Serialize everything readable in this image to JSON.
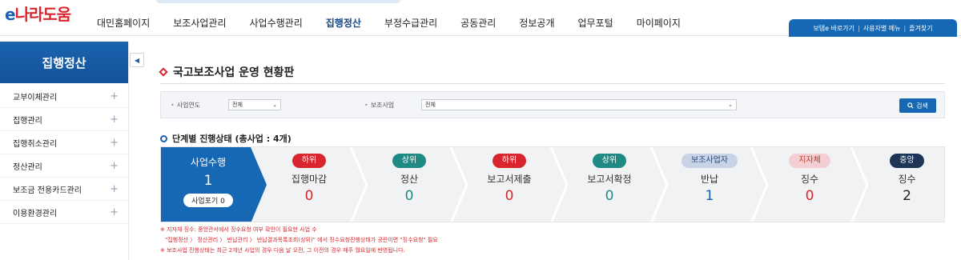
{
  "header": {
    "logo_e": "e",
    "logo_rest": "나라도움",
    "nav": [
      "대민홈페이지",
      "보조사업관리",
      "사업수행관리",
      "집행정산",
      "부정수급관리",
      "공동관리",
      "정보공개",
      "업무포털",
      "마이페이지"
    ],
    "nav_active": "집행정산",
    "quick_links": [
      "보탬e 바로가기",
      "사용자별 메뉴",
      "즐겨찾기"
    ]
  },
  "sidebar": {
    "title": "집행정산",
    "toggle_icon": "◀",
    "items": [
      {
        "label": "교부이체관리"
      },
      {
        "label": "집행관리"
      },
      {
        "label": "집행취소관리"
      },
      {
        "label": "정산관리"
      },
      {
        "label": "보조금 전용카드관리"
      },
      {
        "label": "이용환경관리"
      }
    ]
  },
  "main": {
    "title": "국고보조사업 운영 현황판",
    "search": {
      "year_label": "사업연도",
      "year_value": "전체",
      "project_label": "보조사업",
      "project_value": "전체",
      "button_label": "검색"
    },
    "step_title": "단계별 진행상태 (총사업 : 4개)",
    "stages": [
      {
        "badge": "",
        "label": "사업수행",
        "value": "1",
        "color": "#1667b4"
      },
      {
        "badge": "하위",
        "label": "집행마감",
        "value": "0",
        "color": "#d9262e"
      },
      {
        "badge": "상위",
        "label": "정산",
        "value": "0",
        "color": "#1f8a84"
      },
      {
        "badge": "하위",
        "label": "보고서제출",
        "value": "0",
        "color": "#d9262e"
      },
      {
        "badge": "상위",
        "label": "보고서확정",
        "value": "0",
        "color": "#1f8a84"
      },
      {
        "badge": "보조사업자",
        "label": "반납",
        "value": "1",
        "color": "#c9d3e6"
      },
      {
        "badge": "지자체",
        "label": "징수",
        "value": "0",
        "color": "#f3cfd3"
      },
      {
        "badge": "중앙",
        "label": "징수",
        "value": "2",
        "color": "#1d3557"
      }
    ],
    "abandon_label": "사업포기",
    "abandon_value": "0",
    "notes": [
      "※ 지자체 징수: 중앙관서에서 징수요청 여부 확인이 필요한 사업 수",
      "\"집행정산 〉 정산관리 〉 반납관리 〉 반납결과목록조회(상위)\" 에서 징수요청진행상태가 공란이면 \"징수요청\" 필요",
      "※ 보조사업 진행상태는 최근 2개년 사업의 경우 다음 날 오전, 그 이전의 경우 매주 월요일에 반영됩니다."
    ]
  }
}
